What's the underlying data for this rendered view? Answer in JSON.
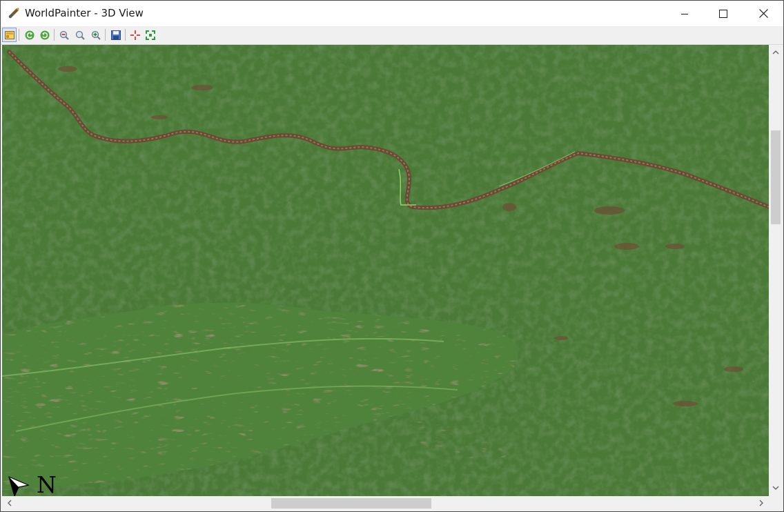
{
  "window": {
    "title": "WorldPainter - 3D View",
    "app_icon": "worldpainter-shovel-icon",
    "controls": {
      "minimize_icon": "minimize-icon",
      "maximize_icon": "maximize-icon",
      "close_icon": "close-icon"
    }
  },
  "toolbar": {
    "buttons": [
      {
        "name": "toggle-layer-button",
        "icon": "layer-toggle-icon",
        "pressed": true
      },
      {
        "name": "rotate-left-button",
        "icon": "rotate-left-icon"
      },
      {
        "name": "rotate-right-button",
        "icon": "rotate-right-icon"
      },
      {
        "name": "zoom-out-button",
        "icon": "zoom-out-icon"
      },
      {
        "name": "zoom-reset-button",
        "icon": "zoom-reset-icon"
      },
      {
        "name": "zoom-in-button",
        "icon": "zoom-in-icon"
      },
      {
        "name": "export-image-button",
        "icon": "save-image-icon"
      },
      {
        "name": "move-to-spawn-button",
        "icon": "crosshair-icon"
      },
      {
        "name": "move-to-origin-button",
        "icon": "fit-view-icon"
      }
    ]
  },
  "view": {
    "compass_letter": "N",
    "colors": {
      "grass": "#4b7a37",
      "grass_dark": "#3d6a2c",
      "grass_light": "#6a9c4c",
      "dirt": "#7a5a3c",
      "river_bank": "#8a6a4c"
    }
  },
  "scrollbars": {
    "vertical_position": 0.19,
    "horizontal_position": 0.35
  }
}
